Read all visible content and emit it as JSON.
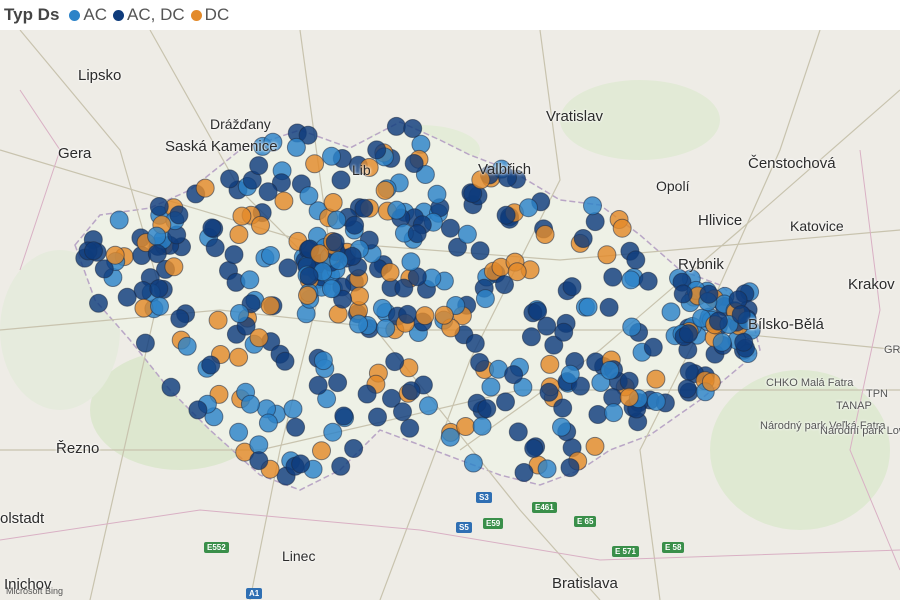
{
  "legend": {
    "title": "Typ Ds",
    "items": [
      {
        "label": "AC",
        "color": "#2c83c8"
      },
      {
        "label": "AC, DC",
        "color": "#0f3c7c"
      },
      {
        "label": "DC",
        "color": "#e38a2a"
      }
    ]
  },
  "map": {
    "cities": [
      "Lipsko",
      "Drážďany",
      "Gera",
      "Saská Kamenice",
      "Vratislav",
      "Valbřich",
      "Čenstochová",
      "Opolí",
      "Hlivice",
      "Katovice",
      "Rybnik",
      "Krakov",
      "Bílsko-Bělá",
      "Řezno",
      "Linec",
      "Bratislava",
      "olstadt",
      "Inichov",
      "Lib"
    ],
    "parks": [
      "CHKO Malá Fatra",
      "Národný park Veľká Fatra",
      "Národní park Low Tatras",
      "TANAP",
      "TPN",
      "GR"
    ],
    "roads": [
      "E552",
      "S3",
      "S5",
      "E59",
      "E461",
      "E 65",
      "E 571",
      "E 58",
      "A1"
    ],
    "attribution": "Microsoft Bing"
  }
}
